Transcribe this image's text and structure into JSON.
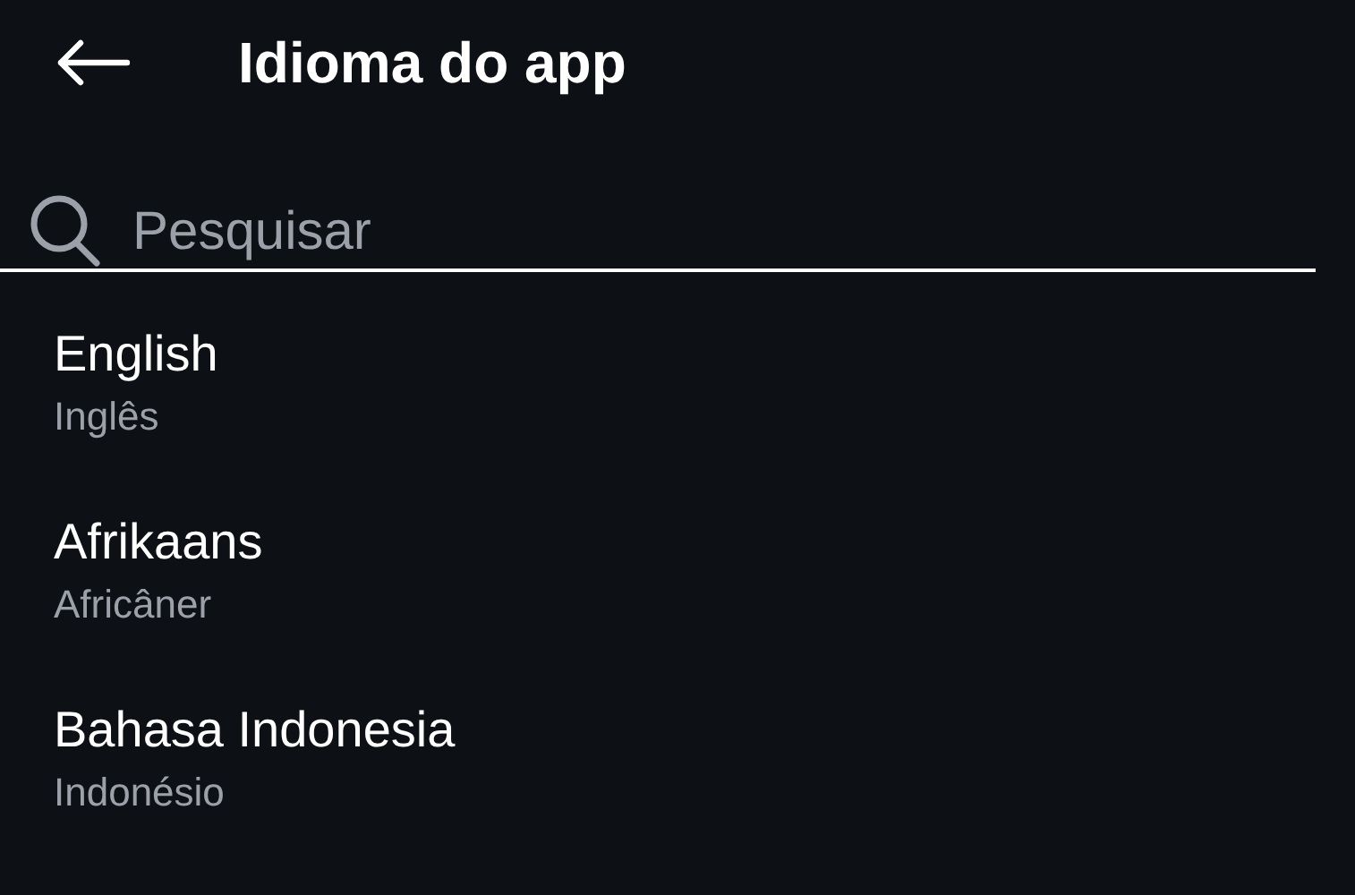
{
  "header": {
    "title": "Idioma do app"
  },
  "search": {
    "placeholder": "Pesquisar"
  },
  "languages": [
    {
      "name": "English",
      "translation": "Inglês"
    },
    {
      "name": "Afrikaans",
      "translation": "Africâner"
    },
    {
      "name": "Bahasa Indonesia",
      "translation": "Indonésio"
    }
  ]
}
